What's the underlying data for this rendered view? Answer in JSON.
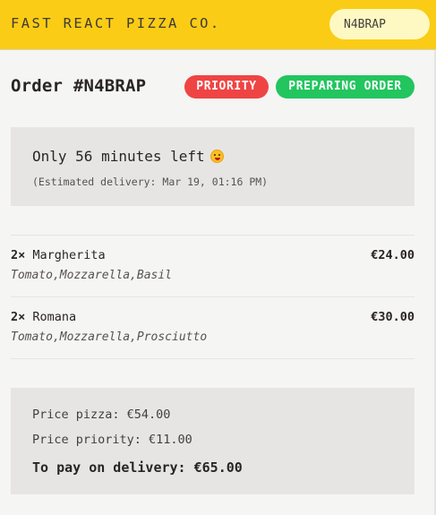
{
  "header": {
    "logo": "FAST REACT PIZZA CO.",
    "search_value": "N4BRAP"
  },
  "order": {
    "title": "Order #N4BRAP",
    "priority_badge": "PRIORITY",
    "status_badge": "PREPARING ORDER",
    "time_left": "Only 56 minutes left",
    "estimated_delivery": "(Estimated delivery: Mar 19, 01:16 PM)"
  },
  "items": [
    {
      "quantity": "2×",
      "name": "Margherita",
      "price": "€24.00",
      "ingredients": "Tomato,Mozzarella,Basil"
    },
    {
      "quantity": "2×",
      "name": "Romana",
      "price": "€30.00",
      "ingredients": "Tomato,Mozzarella,Prosciutto"
    }
  ],
  "summary": {
    "price_pizza": "Price pizza: €54.00",
    "price_priority": "Price priority: €11.00",
    "to_pay": "To pay on delivery: €65.00"
  },
  "colors": {
    "header_bg": "#facc15",
    "priority": "#ef4444",
    "status": "#22c55e"
  }
}
